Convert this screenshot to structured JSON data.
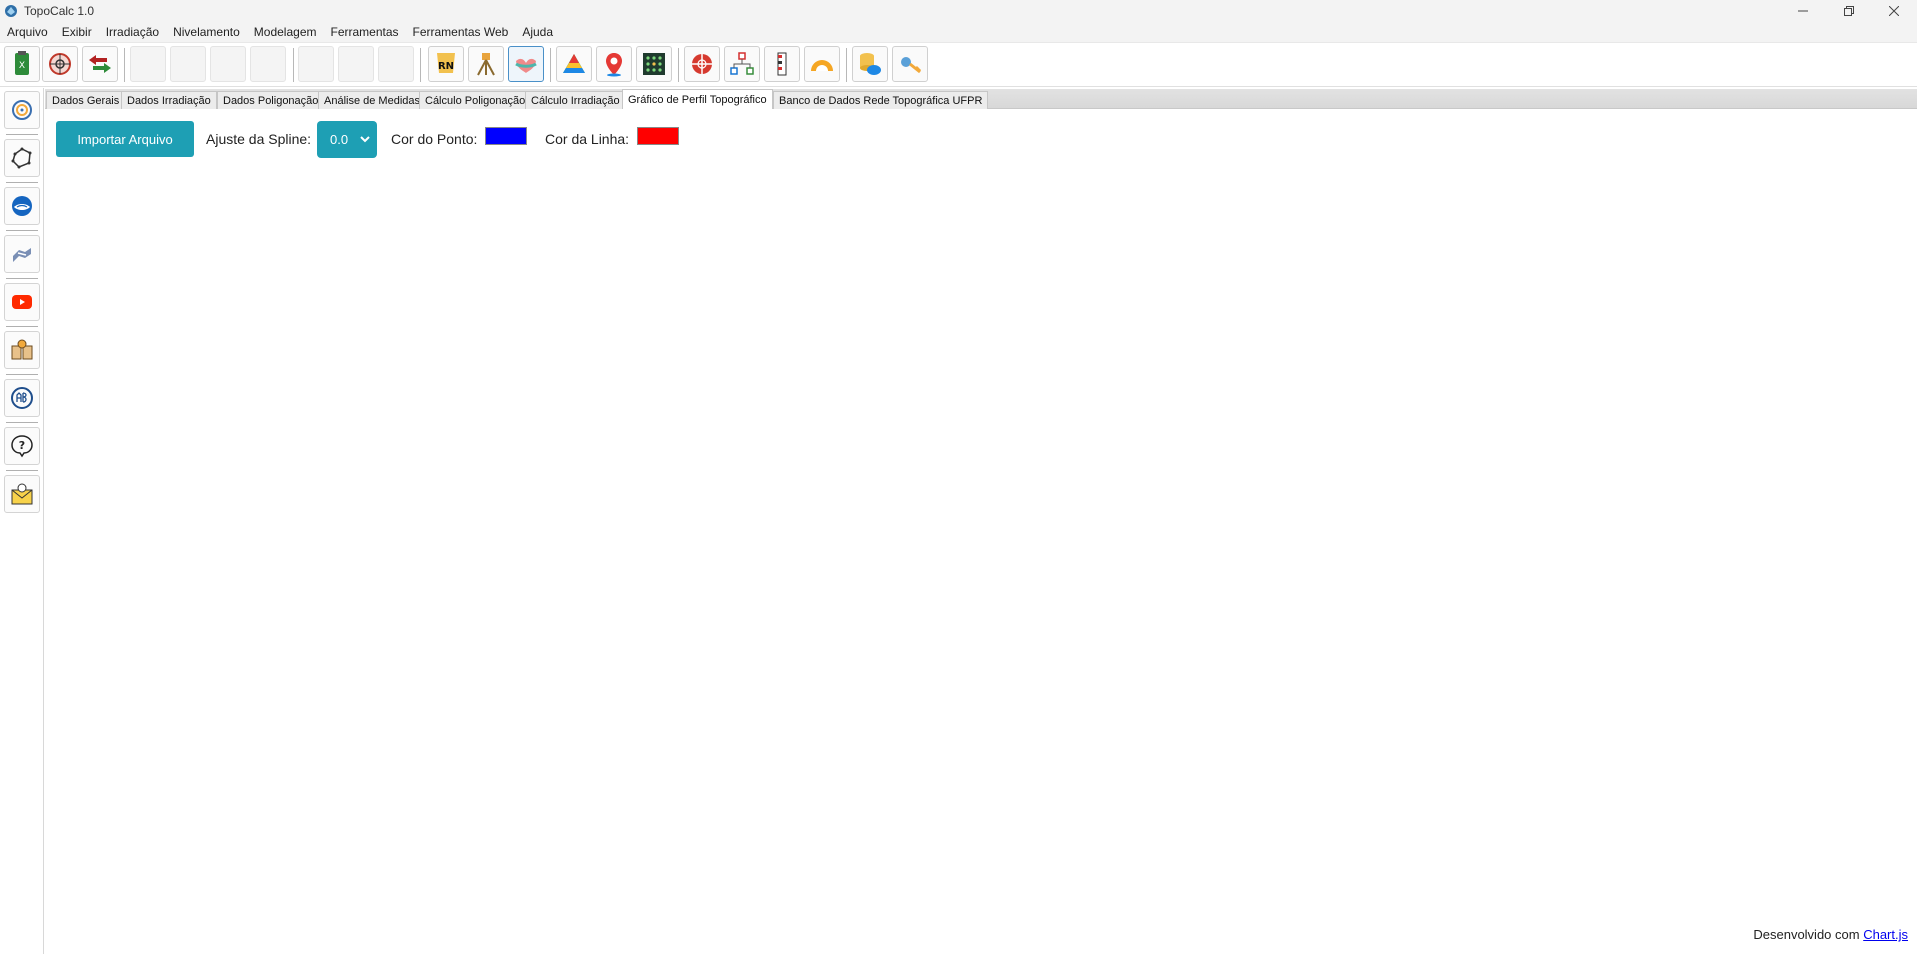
{
  "window": {
    "title": "TopoCalc 1.0",
    "controls": [
      "minimize-icon",
      "restore-icon",
      "close-icon"
    ]
  },
  "menu": {
    "items": [
      "Arquivo",
      "Exibir",
      "Irradiação",
      "Nivelamento",
      "Modelagem",
      "Ferramentas",
      "Ferramentas Web",
      "Ajuda"
    ]
  },
  "toolbar": {
    "rn_label": "RN",
    "icons": [
      "excel-import-icon",
      "target-map-icon",
      "swap-arrows-icon",
      "empty",
      "empty",
      "empty",
      "empty",
      "empty",
      "empty",
      "empty",
      "rn-benchmark-icon",
      "total-station-icon",
      "profile-chart-icon",
      "terrain-model-icon",
      "map-pin-icon",
      "grid-matrix-icon",
      "surveying-globe-icon",
      "network-diagram-icon",
      "level-rod-icon",
      "protractor-icon",
      "cloud-database-icon",
      "key-icon"
    ]
  },
  "sidebar": {
    "icons": [
      "target-icon",
      "polygon-icon",
      "noaa-icon",
      "satellite-icon",
      "youtube-icon",
      "book-icon",
      "abnt-icon",
      "help-icon",
      "mail-icon"
    ]
  },
  "tabs": {
    "items": [
      "Dados Gerais",
      "Dados Irradiação",
      "Dados Poligonação",
      "Análise de Medidas",
      "Cálculo Poligonação",
      "Cálculo Irradiação",
      "Gráfico de Perfil Topográfico",
      "Banco de Dados Rede Topográfica UFPR"
    ],
    "active_index": 6
  },
  "main": {
    "import_button": "Importar Arquivo",
    "spline_label": "Ajuste da Spline:",
    "spline_value": "0.0",
    "point_color_label": "Cor do Ponto:",
    "point_color": "#0000ff",
    "line_color_label": "Cor da Linha:",
    "line_color": "#ff0000"
  },
  "footer": {
    "text": "Desenvolvido com",
    "link": "Chart.js"
  },
  "colors": {
    "accent": "#1e9fb4"
  }
}
